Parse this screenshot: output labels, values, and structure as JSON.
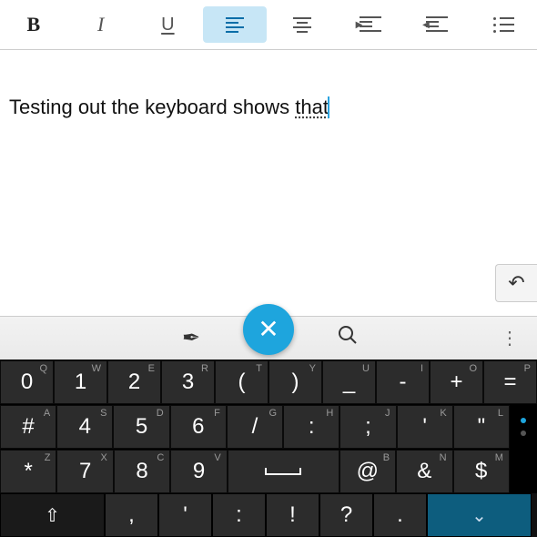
{
  "toolbar": {
    "bold_label": "B",
    "italic_label": "I",
    "underline_label": "U"
  },
  "editor": {
    "text_prefix": "Testing out the keyboard shows ",
    "text_underlined": "that"
  },
  "keyboard": {
    "row1": [
      {
        "main": "0",
        "sup": "Q"
      },
      {
        "main": "1",
        "sup": "W"
      },
      {
        "main": "2",
        "sup": "E"
      },
      {
        "main": "3",
        "sup": "R"
      },
      {
        "main": "(",
        "sup": "T"
      },
      {
        "main": ")",
        "sup": "Y"
      },
      {
        "main": "_",
        "sup": "U"
      },
      {
        "main": "-",
        "sup": "I"
      },
      {
        "main": "+",
        "sup": "O"
      },
      {
        "main": "=",
        "sup": "P"
      }
    ],
    "row2": [
      {
        "main": "#",
        "sup": "A"
      },
      {
        "main": "4",
        "sup": "S"
      },
      {
        "main": "5",
        "sup": "D"
      },
      {
        "main": "6",
        "sup": "F"
      },
      {
        "main": "/",
        "sup": "G"
      },
      {
        "main": ":",
        "sup": "H"
      },
      {
        "main": ";",
        "sup": "J"
      },
      {
        "main": "'",
        "sup": "K"
      },
      {
        "main": "\"",
        "sup": "L"
      }
    ],
    "row3": [
      {
        "main": "*",
        "sup": "Z"
      },
      {
        "main": "7",
        "sup": "X"
      },
      {
        "main": "8",
        "sup": "C"
      },
      {
        "main": "9",
        "sup": "V"
      },
      {
        "main": "␣",
        "sup": ""
      },
      {
        "main": "@",
        "sup": "B"
      },
      {
        "main": "&",
        "sup": "N"
      },
      {
        "main": "$",
        "sup": "M"
      }
    ],
    "bottom": {
      "comma": ",",
      "apostrophe": "'",
      "colon": ":",
      "exclaim": "!",
      "question": "?",
      "period": "."
    }
  }
}
